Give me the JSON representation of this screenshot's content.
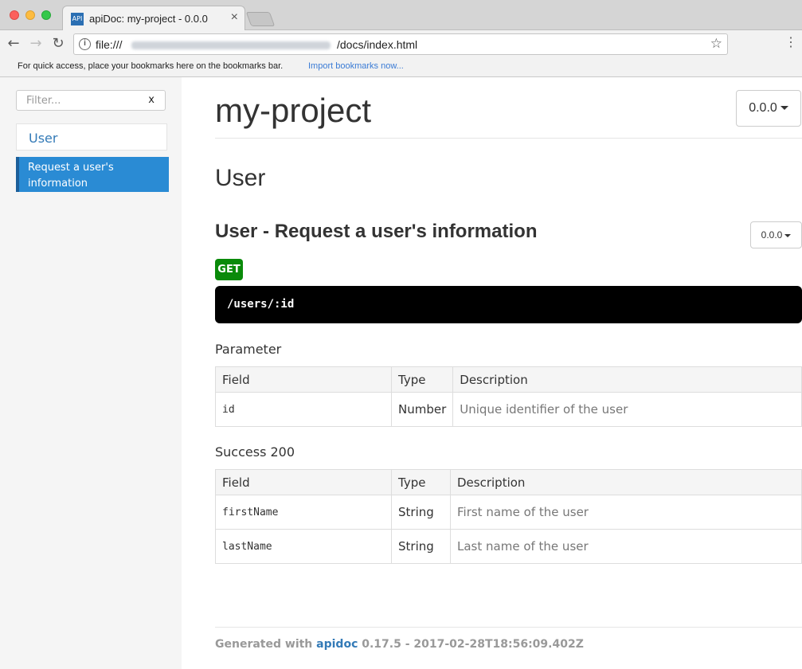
{
  "browser": {
    "tab_title": "apiDoc: my-project - 0.0.0",
    "tab_favicon_text": "API",
    "url_prefix": "file:///",
    "url_suffix": "/docs/index.html",
    "bookmarks_text": "For quick access, place your bookmarks here on the bookmarks bar.",
    "bookmarks_link": "Import bookmarks now..."
  },
  "sidebar": {
    "filter_placeholder": "Filter...",
    "filter_clear": "x",
    "group_label": "User",
    "items": [
      {
        "label": "Request a user's information",
        "active": true
      }
    ]
  },
  "header": {
    "project_name": "my-project",
    "version": "0.0.0"
  },
  "group": {
    "title": "User"
  },
  "endpoint": {
    "title": "User - Request a user's information",
    "version": "0.0.0",
    "method": "GET",
    "url": "/users/:id"
  },
  "parameter": {
    "title": "Parameter",
    "headers": [
      "Field",
      "Type",
      "Description"
    ],
    "rows": [
      {
        "field": "id",
        "type": "Number",
        "description": "Unique identifier of the user"
      }
    ]
  },
  "success": {
    "title": "Success 200",
    "headers": [
      "Field",
      "Type",
      "Description"
    ],
    "rows": [
      {
        "field": "firstName",
        "type": "String",
        "description": "First name of the user"
      },
      {
        "field": "lastName",
        "type": "String",
        "description": "Last name of the user"
      }
    ]
  },
  "footer": {
    "prefix": "Generated with ",
    "link": "apidoc",
    "suffix": " 0.17.5 - 2017-02-28T18:56:09.402Z"
  },
  "colors": {
    "accent": "#337ab7",
    "active_item": "#2a8bd4",
    "get_badge": "#0a8a0a"
  }
}
